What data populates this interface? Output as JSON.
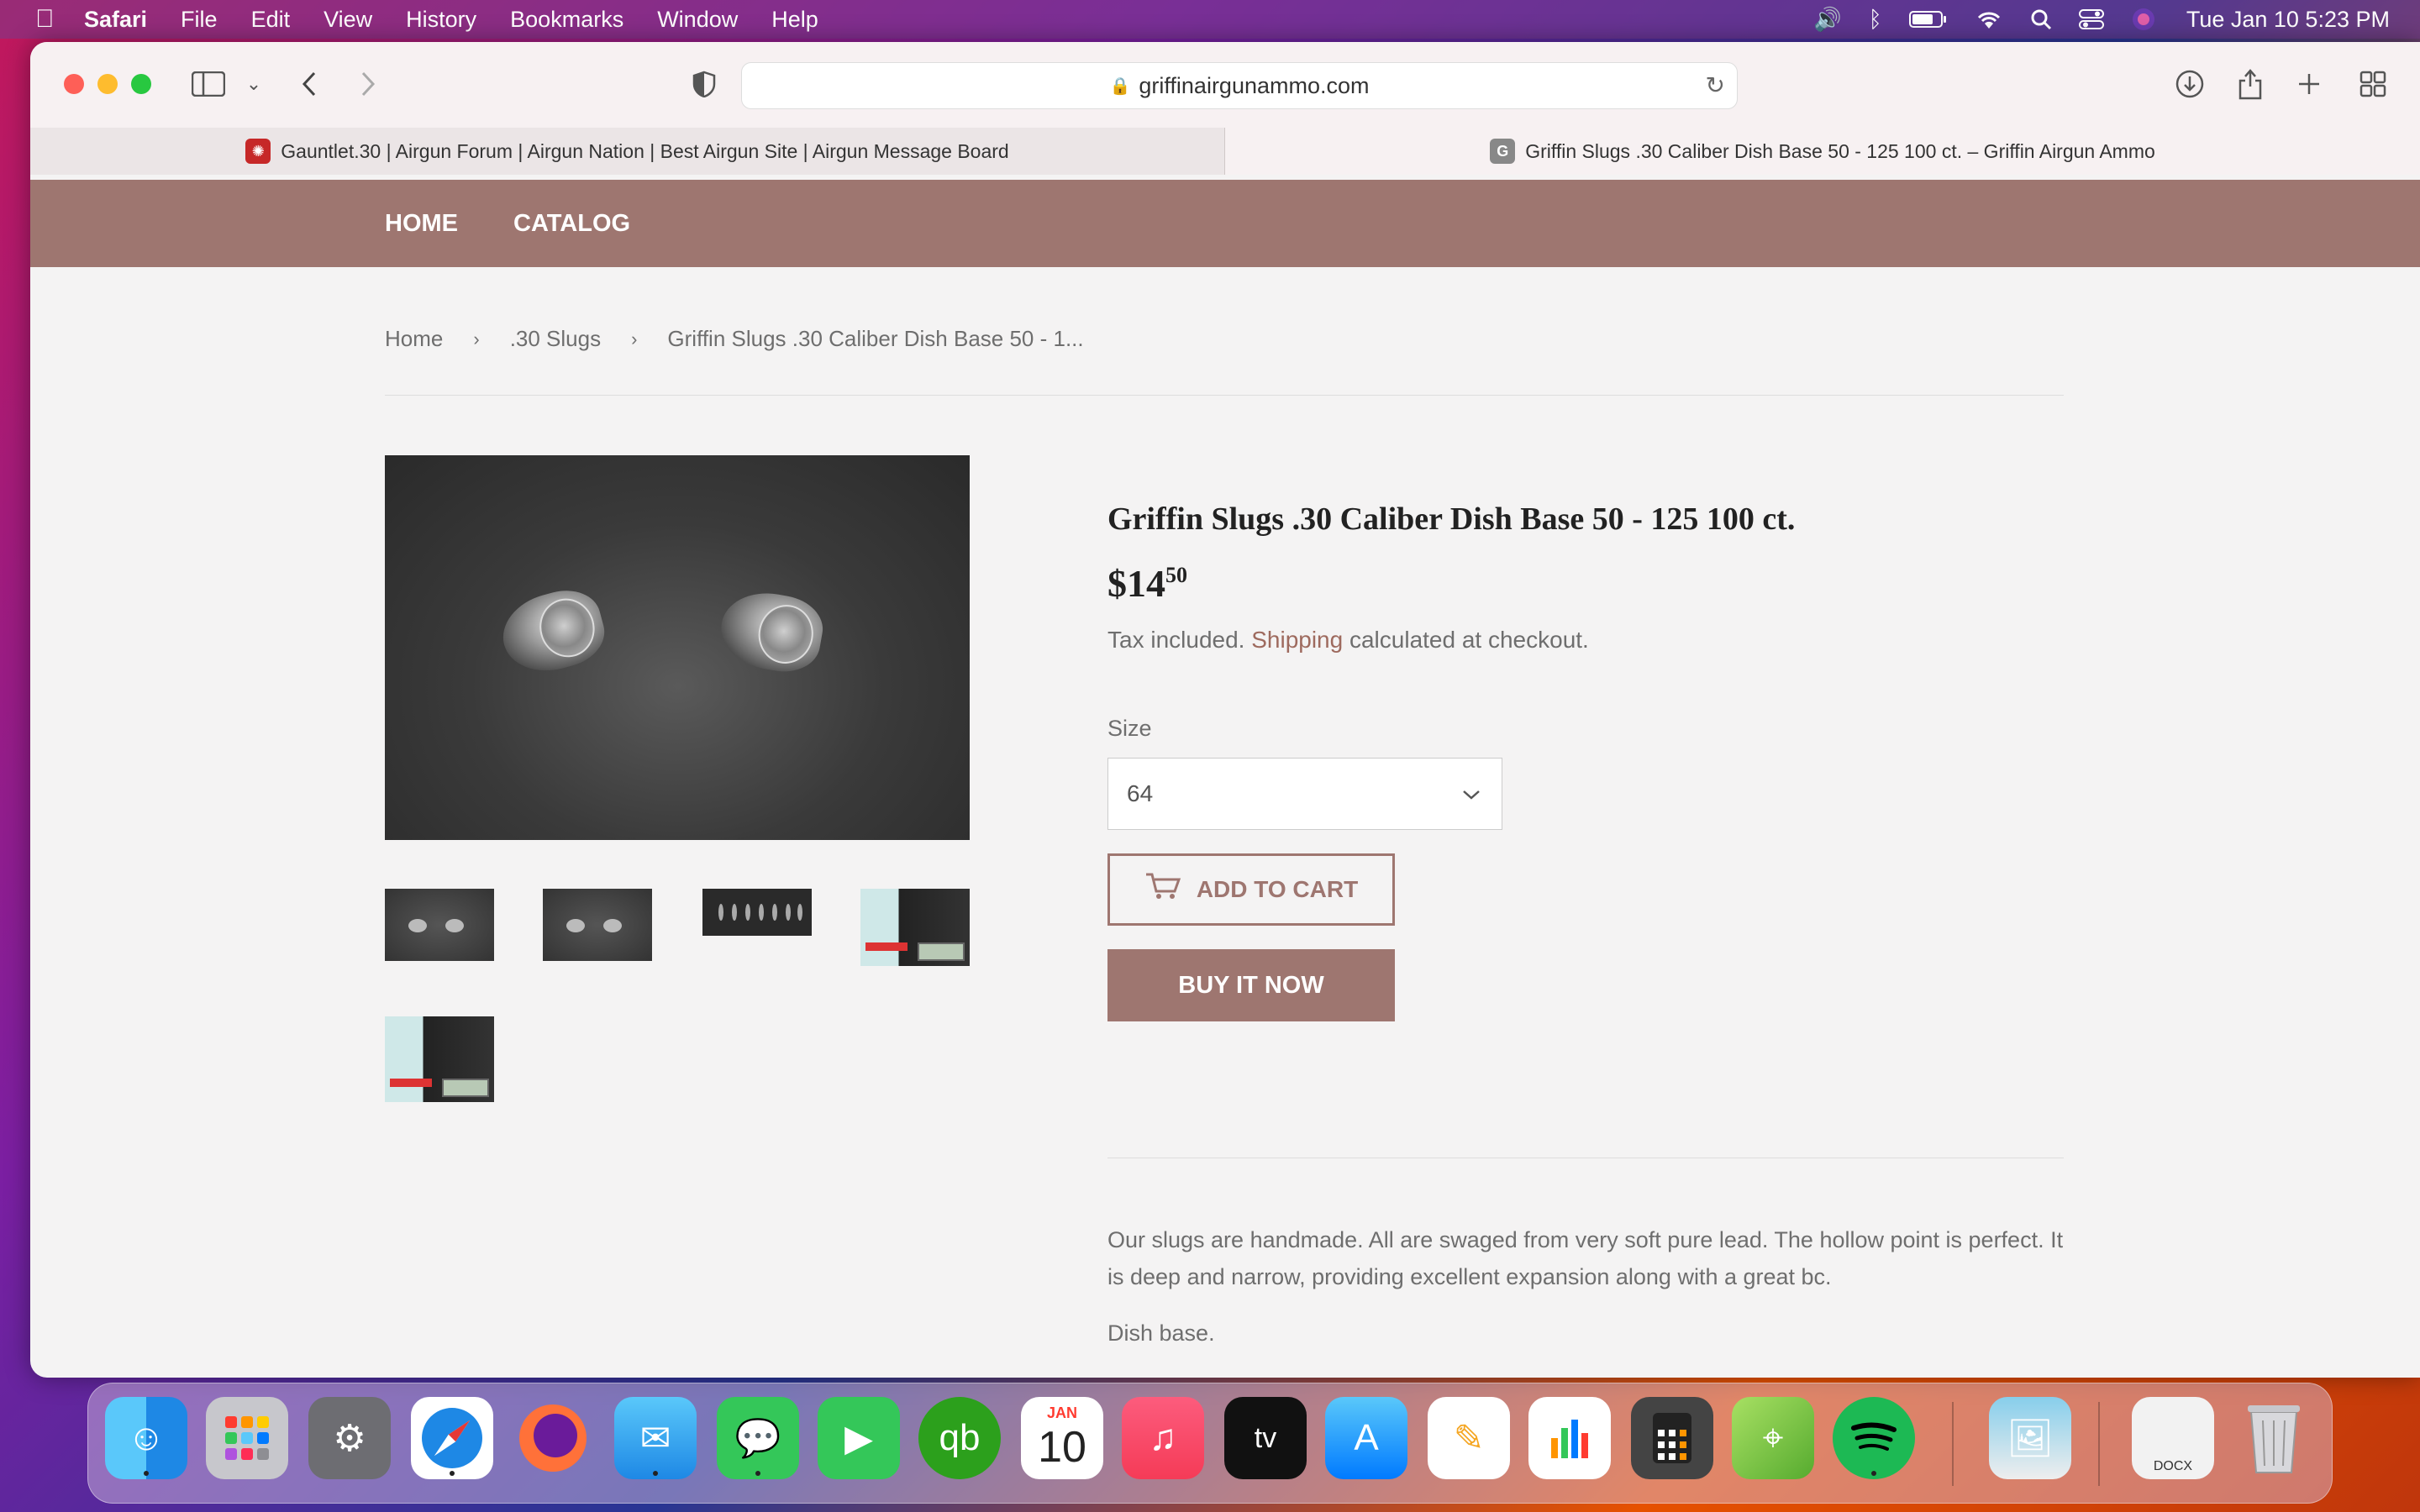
{
  "menubar": {
    "app_name": "Safari",
    "items": [
      "File",
      "Edit",
      "View",
      "History",
      "Bookmarks",
      "Window",
      "Help"
    ],
    "clock": "Tue Jan 10  5:23 PM"
  },
  "browser": {
    "url": "griffinairgunammo.com",
    "tabs": [
      {
        "title": "Gauntlet.30 | Airgun Forum | Airgun Nation | Best Airgun Site | Airgun Message Board",
        "favicon_letter": "✺"
      },
      {
        "title": "Griffin Slugs .30 Caliber Dish Base 50 - 125 100 ct. – Griffin Airgun Ammo",
        "favicon_letter": "G"
      }
    ]
  },
  "site": {
    "nav": {
      "home": "HOME",
      "catalog": "CATALOG"
    },
    "breadcrumb": {
      "home": "Home",
      "category": ".30 Slugs",
      "current": "Griffin Slugs .30 Caliber Dish Base 50 - 1..."
    },
    "product": {
      "title": "Griffin Slugs .30 Caliber Dish Base 50 - 125 100 ct.",
      "price_main": "$14",
      "price_cents": "50",
      "tax_prefix": "Tax included. ",
      "shipping_link": "Shipping",
      "tax_suffix": " calculated at checkout.",
      "size_label": "Size",
      "size_value": "64",
      "add_to_cart": "ADD TO CART",
      "buy_now": "BUY IT NOW",
      "description": "Our slugs are handmade. All are swaged from very soft pure lead. The hollow point is perfect. It is deep and narrow, providing excellent expansion along with a great bc.",
      "description2": "Dish base."
    }
  },
  "dock": {
    "calendar_month": "JAN",
    "calendar_day": "10",
    "docx_label": "DOCX"
  },
  "colors": {
    "brand": "#9e7670",
    "link": "#9e6a5e"
  }
}
